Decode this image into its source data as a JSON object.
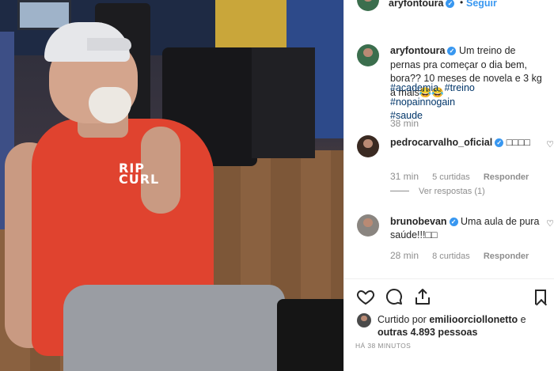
{
  "header": {
    "username": "aryfontoura",
    "separator": "•",
    "follow_label": "Seguir"
  },
  "caption": {
    "username": "aryfontoura",
    "text": "Um treino de pernas pra começar o dia bem, bora?? 10 meses de novela e 3 kg a mais😂😂",
    "hashtags": [
      "#academia",
      "#treino",
      "#nopainnogain",
      "#saude"
    ],
    "time": "38 min"
  },
  "comments": [
    {
      "username": "pedrocarvalho_oficial",
      "text": "□□□□",
      "time": "31 min",
      "likes": "5 curtidas",
      "reply_label": "Responder",
      "view_replies": "Ver respostas (1)"
    },
    {
      "username": "brunobevan",
      "text": "Uma aula de pura saúde!!!□□",
      "time": "28 min",
      "likes": "8 curtidas",
      "reply_label": "Responder"
    }
  ],
  "actions": {
    "like_icon": "heart-icon",
    "comment_icon": "comment-icon",
    "share_icon": "share-icon",
    "save_icon": "bookmark-icon"
  },
  "likes_summary": {
    "prefix": "Curtido por",
    "user": "emilioorciollonetto",
    "middle": "e",
    "others": "outras 4.893 pessoas"
  },
  "posted_time": "HÁ 38 MINUTOS",
  "photo": {
    "shirt_logo_line1": "RIP",
    "shirt_logo_line2": "CURL"
  },
  "colors": {
    "link": "#3897f0",
    "hashtag": "#003569",
    "muted": "#8e8e8e",
    "text": "#262626"
  }
}
